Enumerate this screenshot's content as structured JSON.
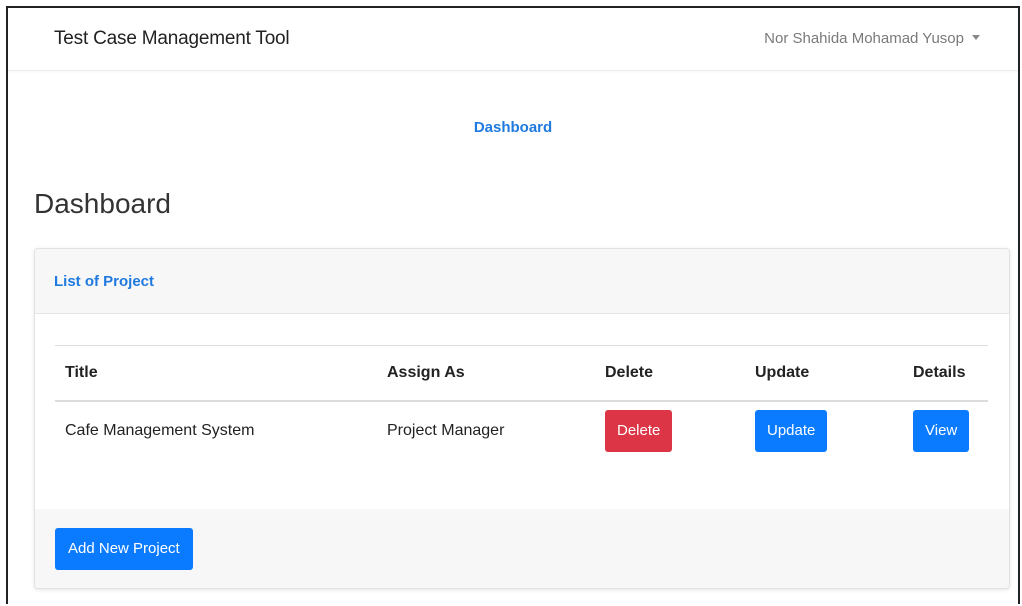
{
  "navbar": {
    "brand": "Test Case Management Tool",
    "user_name": "Nor Shahida Mohamad Yusop"
  },
  "nav": {
    "dashboard_link": "Dashboard"
  },
  "page": {
    "title": "Dashboard"
  },
  "card": {
    "header": "List of Project",
    "table": {
      "columns": [
        "Title",
        "Assign As",
        "Delete",
        "Update",
        "Details"
      ],
      "rows": [
        {
          "title": "Cafe Management System",
          "assign_as": "Project Manager",
          "delete_label": "Delete",
          "update_label": "Update",
          "view_label": "View"
        }
      ]
    },
    "footer": {
      "add_button": "Add New Project"
    }
  },
  "colors": {
    "primary": "#0a7bff",
    "danger": "#dc3545",
    "link": "#1f7ae0"
  }
}
